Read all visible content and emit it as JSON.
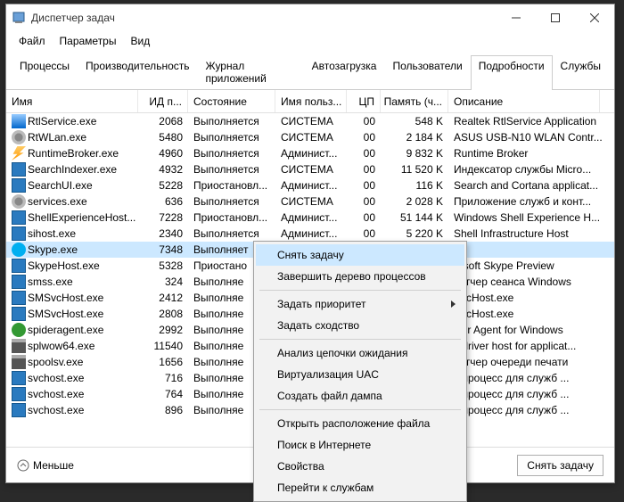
{
  "title": "Диспетчер задач",
  "menubar": [
    "Файл",
    "Параметры",
    "Вид"
  ],
  "tabs": {
    "items": [
      "Процессы",
      "Производительность",
      "Журнал приложений",
      "Автозагрузка",
      "Пользователи",
      "Подробности",
      "Службы"
    ],
    "active": 5
  },
  "columns": {
    "name": "Имя",
    "pid": "ИД п...",
    "state": "Состояние",
    "user": "Имя польз...",
    "cpu": "ЦП",
    "mem": "Память (ч...",
    "desc": "Описание"
  },
  "processes": [
    {
      "icon": "ic-serv",
      "name": "RtlService.exe",
      "pid": "2068",
      "state": "Выполняется",
      "user": "СИСТЕМА",
      "cpu": "00",
      "mem": "548 K",
      "desc": "Realtek RtlService Application"
    },
    {
      "icon": "ic-cog",
      "name": "RtWLan.exe",
      "pid": "5480",
      "state": "Выполняется",
      "user": "СИСТЕМА",
      "cpu": "00",
      "mem": "2 184 K",
      "desc": "ASUS USB-N10 WLAN Contr..."
    },
    {
      "icon": "ic-bolt",
      "name": "RuntimeBroker.exe",
      "pid": "4960",
      "state": "Выполняется",
      "user": "Админист...",
      "cpu": "00",
      "mem": "9 832 K",
      "desc": "Runtime Broker"
    },
    {
      "icon": "ic-mon",
      "name": "SearchIndexer.exe",
      "pid": "4932",
      "state": "Выполняется",
      "user": "СИСТЕМА",
      "cpu": "00",
      "mem": "11 520 K",
      "desc": "Индексатор службы Micro..."
    },
    {
      "icon": "ic-mon",
      "name": "SearchUI.exe",
      "pid": "5228",
      "state": "Приостановл...",
      "user": "Админист...",
      "cpu": "00",
      "mem": "116 K",
      "desc": "Search and Cortana applicat..."
    },
    {
      "icon": "ic-cog",
      "name": "services.exe",
      "pid": "636",
      "state": "Выполняется",
      "user": "СИСТЕМА",
      "cpu": "00",
      "mem": "2 028 K",
      "desc": "Приложение служб и конт..."
    },
    {
      "icon": "ic-mon",
      "name": "ShellExperienceHost...",
      "pid": "7228",
      "state": "Приостановл...",
      "user": "Админист...",
      "cpu": "00",
      "mem": "51 144 K",
      "desc": "Windows Shell Experience H..."
    },
    {
      "icon": "ic-mon",
      "name": "sihost.exe",
      "pid": "2340",
      "state": "Выполняется",
      "user": "Админист...",
      "cpu": "00",
      "mem": "5 220 K",
      "desc": "Shell Infrastructure Host"
    },
    {
      "icon": "ic-skype",
      "name": "Skype.exe",
      "pid": "7348",
      "state": "Выполняет",
      "user": "",
      "cpu": "",
      "mem": "",
      "desc": ""
    },
    {
      "icon": "ic-mon",
      "name": "SkypeHost.exe",
      "pid": "5328",
      "state": "Приостано",
      "user": "",
      "cpu": "",
      "mem": "",
      "desc": "rosoft Skype Preview"
    },
    {
      "icon": "ic-mon",
      "name": "smss.exe",
      "pid": "324",
      "state": "Выполняе",
      "user": "",
      "cpu": "",
      "mem": "",
      "desc": "петчер сеанса  Windows"
    },
    {
      "icon": "ic-mon",
      "name": "SMSvcHost.exe",
      "pid": "2412",
      "state": "Выполняе",
      "user": "",
      "cpu": "",
      "mem": "",
      "desc": "SvcHost.exe"
    },
    {
      "icon": "ic-mon",
      "name": "SMSvcHost.exe",
      "pid": "2808",
      "state": "Выполняе",
      "user": "",
      "cpu": "",
      "mem": "",
      "desc": "SvcHost.exe"
    },
    {
      "icon": "ic-spider",
      "name": "spideragent.exe",
      "pid": "2992",
      "state": "Выполняе",
      "user": "",
      "cpu": "",
      "mem": "",
      "desc": "Der Agent for Windows"
    },
    {
      "icon": "ic-print",
      "name": "splwow64.exe",
      "pid": "11540",
      "state": "Выполняе",
      "user": "",
      "cpu": "",
      "mem": "",
      "desc": "it driver host for applicat..."
    },
    {
      "icon": "ic-print",
      "name": "spoolsv.exe",
      "pid": "1656",
      "state": "Выполняе",
      "user": "",
      "cpu": "",
      "mem": "",
      "desc": "петчер очереди печати"
    },
    {
      "icon": "ic-mon",
      "name": "svchost.exe",
      "pid": "716",
      "state": "Выполняе",
      "user": "",
      "cpu": "",
      "mem": "",
      "desc": "т-процесс для служб ..."
    },
    {
      "icon": "ic-mon",
      "name": "svchost.exe",
      "pid": "764",
      "state": "Выполняе",
      "user": "",
      "cpu": "",
      "mem": "",
      "desc": "т-процесс для служб ..."
    },
    {
      "icon": "ic-mon",
      "name": "svchost.exe",
      "pid": "896",
      "state": "Выполняе",
      "user": "",
      "cpu": "",
      "mem": "",
      "desc": "т-процесс для служб ..."
    }
  ],
  "selectedIndex": 8,
  "context_menu": {
    "items": [
      {
        "label": "Снять задачу",
        "hl": true
      },
      {
        "label": "Завершить дерево процессов"
      },
      {
        "sep": true
      },
      {
        "label": "Задать приоритет",
        "sub": true
      },
      {
        "label": "Задать сходство"
      },
      {
        "sep": true
      },
      {
        "label": "Анализ цепочки ожидания"
      },
      {
        "label": "Виртуализация UAC"
      },
      {
        "label": "Создать файл дампа"
      },
      {
        "sep": true
      },
      {
        "label": "Открыть расположение файла"
      },
      {
        "label": "Поиск в Интернете"
      },
      {
        "label": "Свойства"
      },
      {
        "label": "Перейти к службам"
      }
    ]
  },
  "footer": {
    "fewer": "Меньше",
    "end_task": "Снять задачу"
  }
}
